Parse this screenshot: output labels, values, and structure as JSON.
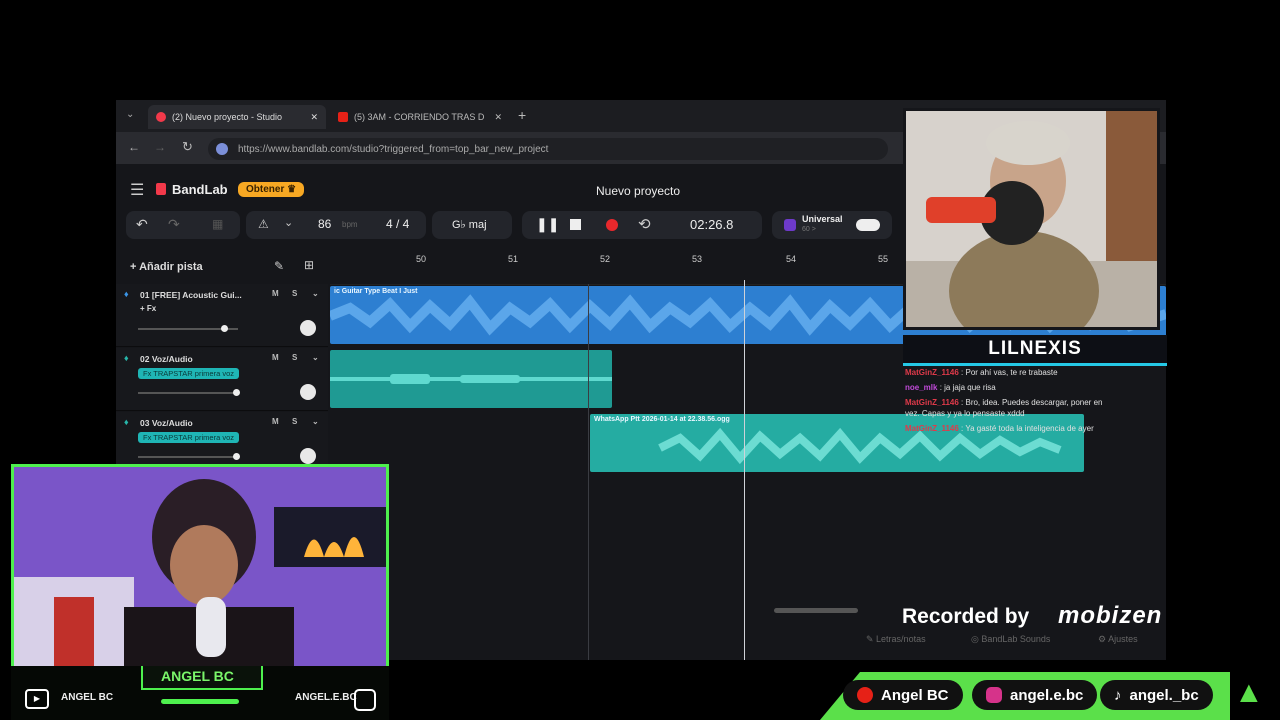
{
  "browser": {
    "tabs": [
      {
        "label": "(2) Nuevo proyecto - Studio",
        "active": true
      },
      {
        "label": "(5) 3AM - CORRIENDO TRAS D",
        "active": false
      }
    ],
    "url": "https://www.bandlab.com/studio?triggered_from=top_bar_new_project"
  },
  "bandlab": {
    "logo": "BandLab",
    "get_button": "Obtener",
    "project_title": "Nuevo proyecto",
    "tempo": "86",
    "tempo_unit": "bpm",
    "time_signature": "4 / 4",
    "key": "G♭ maj",
    "timecode": "02:26.8",
    "preset_name": "Universal",
    "preset_sub": "60 >",
    "add_track": "Añadir pista",
    "ruler": [
      "50",
      "51",
      "52",
      "53",
      "54",
      "55"
    ],
    "tracks": [
      {
        "name": "01 [FREE] Acoustic Gui...",
        "fx": "+ Fx",
        "clip": "ic Guitar Type Beat I Just"
      },
      {
        "name": "02 Voz/Audio",
        "fx": "Fx TRAPSTAR primera voz",
        "clip": ""
      },
      {
        "name": "03 Voz/Audio",
        "fx": "Fx TRAPSTAR primera voz",
        "clip": "WhatsApp Ptt 2026-01-14 at 22.38.56.ogg"
      }
    ],
    "ms": [
      "M",
      "S"
    ],
    "bottom": [
      "Letras/notas",
      "BandLab Sounds",
      "Ajustes"
    ]
  },
  "overlay": {
    "streamer2": "LILNEXIS",
    "streamer1": "ANGEL BC",
    "cam1_left_label": "ANGEL BC",
    "cam1_right_label": "ANGEL.E.BC",
    "recorded": "Recorded by",
    "recorder_brand": "mobizen",
    "chat": [
      {
        "user": "MatGinZ_1146",
        "msg": "Por ahí vas, te re trabaste"
      },
      {
        "user": "noe_mlk",
        "msg": "ja jaja que risa"
      },
      {
        "user": "MatGinZ_1146",
        "msg": "Bro, idea. Puedes descargar, poner en"
      },
      {
        "user": "",
        "msg": "vez. Capas y ya lo pensaste xddd"
      },
      {
        "user": "MatGinZ_1146",
        "msg": "Ya gasté toda la inteligencia de ayer"
      }
    ],
    "socials": [
      "Angel BC",
      "angel.e.bc",
      "angel._bc"
    ],
    "colors": {
      "accent_green": "#5be04a",
      "accent_cyan": "#25c8e6",
      "waveform_blue": "#3b95e6",
      "waveform_teal": "#27b5a9"
    }
  }
}
